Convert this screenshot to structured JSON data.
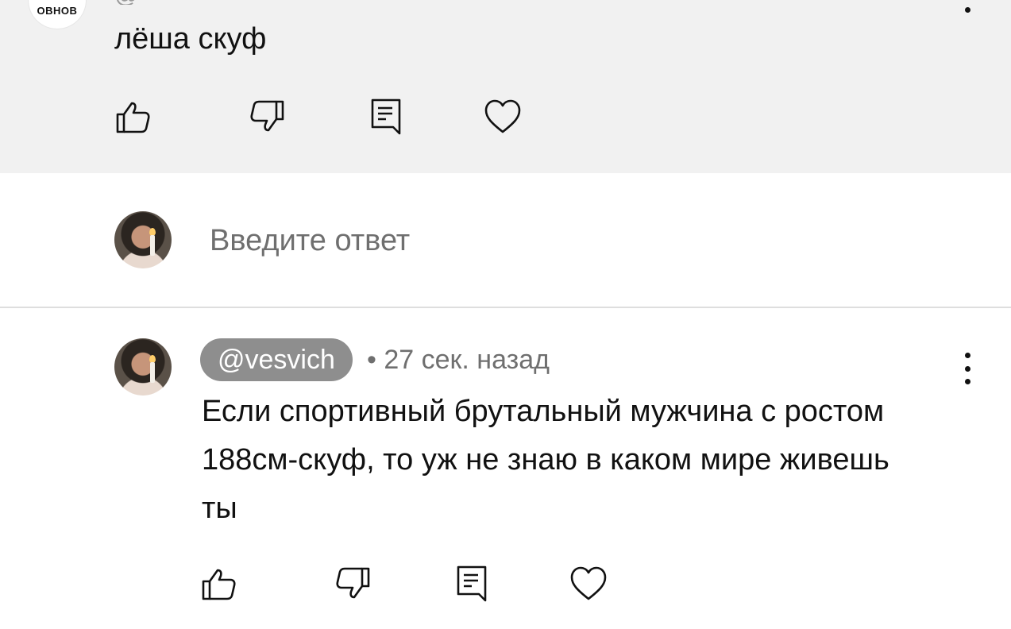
{
  "top_comment": {
    "avatar_text": "ОВНОВ",
    "handle_partial": "@",
    "text": "лёша скуф"
  },
  "reply": {
    "placeholder": "Введите ответ"
  },
  "comment": {
    "handle": "@vesvich",
    "separator": "•",
    "time": "27 сек. назад",
    "text": "Если спортивный брутальный мужчина с ростом 188см-скуф, то уж не знаю в каком мире живешь ты"
  },
  "icons": [
    "like-icon",
    "dislike-icon",
    "reply-icon",
    "heart-icon",
    "more-icon"
  ]
}
